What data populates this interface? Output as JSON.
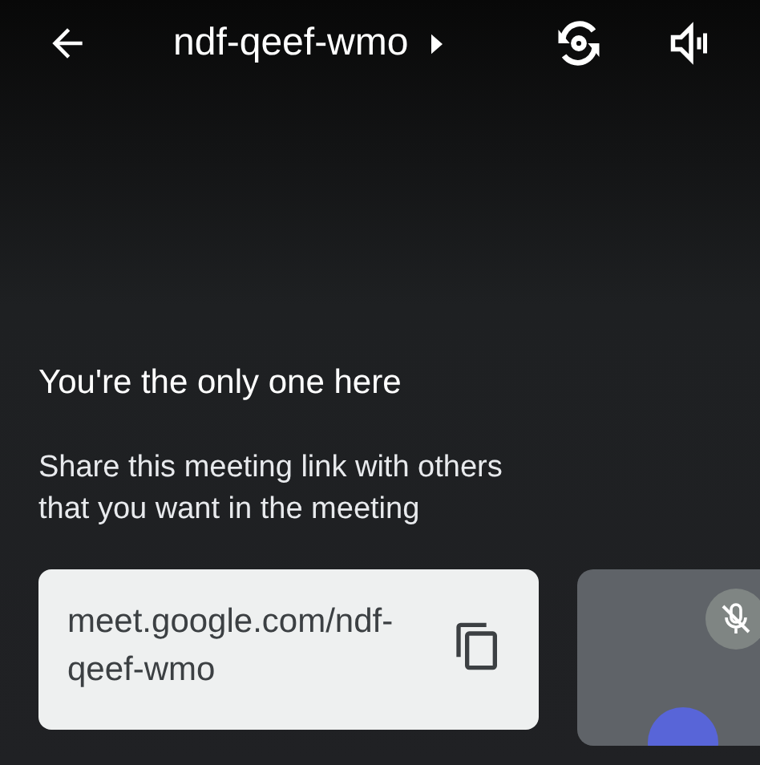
{
  "top_bar": {
    "meeting_code": "ndf-qeef-wmo"
  },
  "message": {
    "heading": "You're the only one here",
    "body": "Share this meeting link with others that you want in the meeting"
  },
  "link_card": {
    "link": "meet.google.com/ndf-qeef-wmo"
  },
  "self_view": {
    "muted": true
  }
}
